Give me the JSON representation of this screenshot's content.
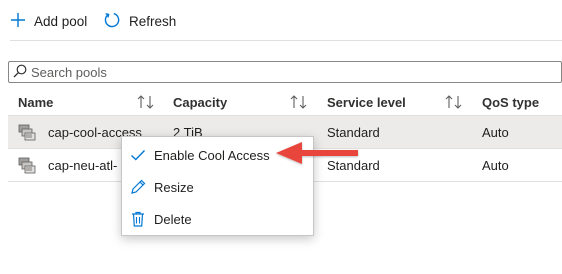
{
  "toolbar": {
    "add_pool_label": "Add pool",
    "refresh_label": "Refresh"
  },
  "search": {
    "placeholder": "Search pools"
  },
  "table": {
    "columns": [
      "Name",
      "Capacity",
      "Service level",
      "QoS type"
    ],
    "rows": [
      {
        "name": "cap-cool-access",
        "capacity": "2 TiB",
        "service_level": "Standard",
        "qos_type": "Auto",
        "selected": true
      },
      {
        "name": "cap-neu-atl-",
        "capacity": "",
        "service_level": "Standard",
        "qos_type": "Auto",
        "selected": false
      }
    ]
  },
  "context_menu": {
    "items": [
      {
        "label": "Enable Cool Access",
        "icon": "checkmark-icon"
      },
      {
        "label": "Resize",
        "icon": "pencil-icon"
      },
      {
        "label": "Delete",
        "icon": "trash-icon"
      }
    ]
  },
  "colors": {
    "accent": "#0078d4",
    "callout_arrow": "#e8453c",
    "selected_row": "#edebe9"
  }
}
